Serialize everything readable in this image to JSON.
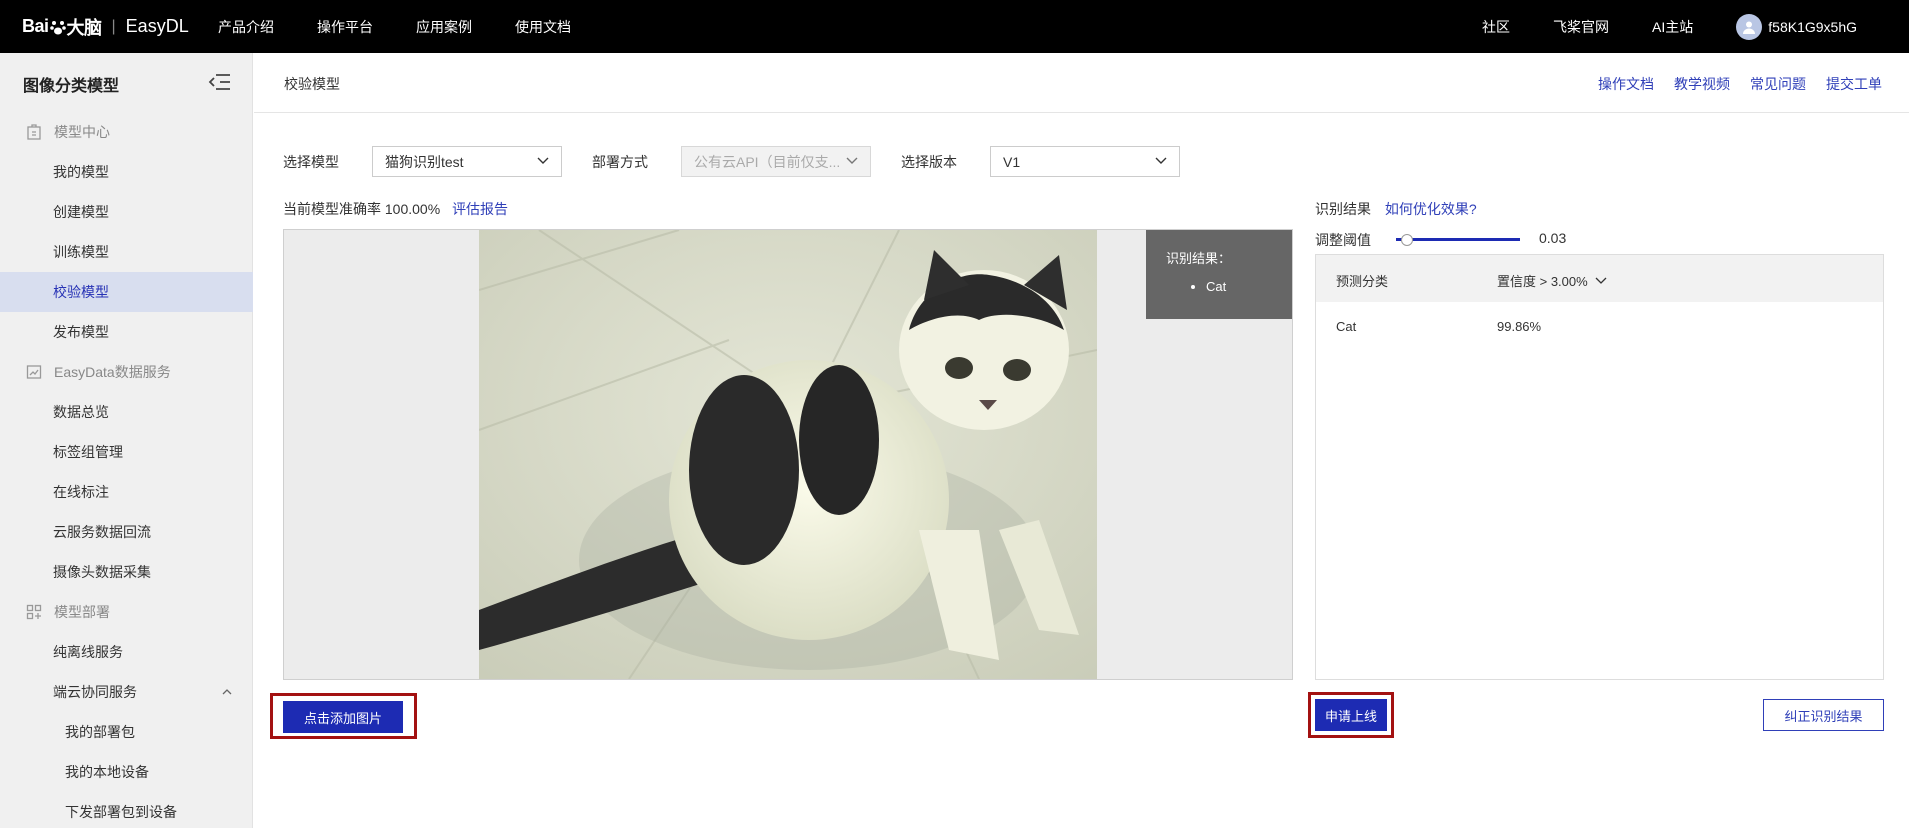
{
  "topnav": {
    "logo_brand": "Bai",
    "logo_brand_cn": "大脑",
    "logo_product": "EasyDL",
    "menu": [
      "产品介绍",
      "操作平台",
      "应用案例",
      "使用文档"
    ],
    "right_links": [
      "社区",
      "飞桨官网",
      "AI主站"
    ],
    "username": "f58K1G9x5hG"
  },
  "sidebar": {
    "title": "图像分类模型",
    "groups": [
      {
        "label": "模型中心",
        "icon": "building-icon",
        "items": [
          "我的模型",
          "创建模型",
          "训练模型",
          "校验模型",
          "发布模型"
        ]
      },
      {
        "label": "EasyData数据服务",
        "icon": "chart-icon",
        "items": [
          "数据总览",
          "标签组管理",
          "在线标注",
          "云服务数据回流",
          "摄像头数据采集"
        ]
      },
      {
        "label": "模型部署",
        "icon": "deploy-icon",
        "items": [
          "纯离线服务",
          "端云协同服务"
        ],
        "subitems": [
          "我的部署包",
          "我的本地设备",
          "下发部署包到设备"
        ]
      }
    ],
    "active_item": "校验模型"
  },
  "page": {
    "title": "校验模型",
    "links": [
      "操作文档",
      "教学视频",
      "常见问题",
      "提交工单"
    ]
  },
  "form": {
    "model_label": "选择模型",
    "model_value": "猫狗识别test",
    "deploy_label": "部署方式",
    "deploy_value": "公有云API（目前仅支...",
    "version_label": "选择版本",
    "version_value": "V1"
  },
  "accuracy": {
    "label": "当前模型准确率",
    "value": "100.00%",
    "report_link": "评估报告"
  },
  "overlay": {
    "title": "识别结果：",
    "items": [
      "Cat"
    ]
  },
  "add_image_button": "点击添加图片",
  "result": {
    "title": "识别结果",
    "optimize_link": "如何优化效果?",
    "threshold_label": "调整阈值",
    "threshold_value": "0.03",
    "threshold_fraction": 0.03,
    "col_class": "预测分类",
    "col_confidence": "置信度 > 3.00%",
    "rows": [
      {
        "class": "Cat",
        "confidence": "99.86%"
      }
    ]
  },
  "apply_button": "申请上线",
  "correct_button": "纠正识别结果",
  "colors": {
    "primary": "#1d2bb3",
    "link": "#2f3fb8",
    "highlight_border": "#a31111",
    "active_bg": "#d8deef"
  }
}
